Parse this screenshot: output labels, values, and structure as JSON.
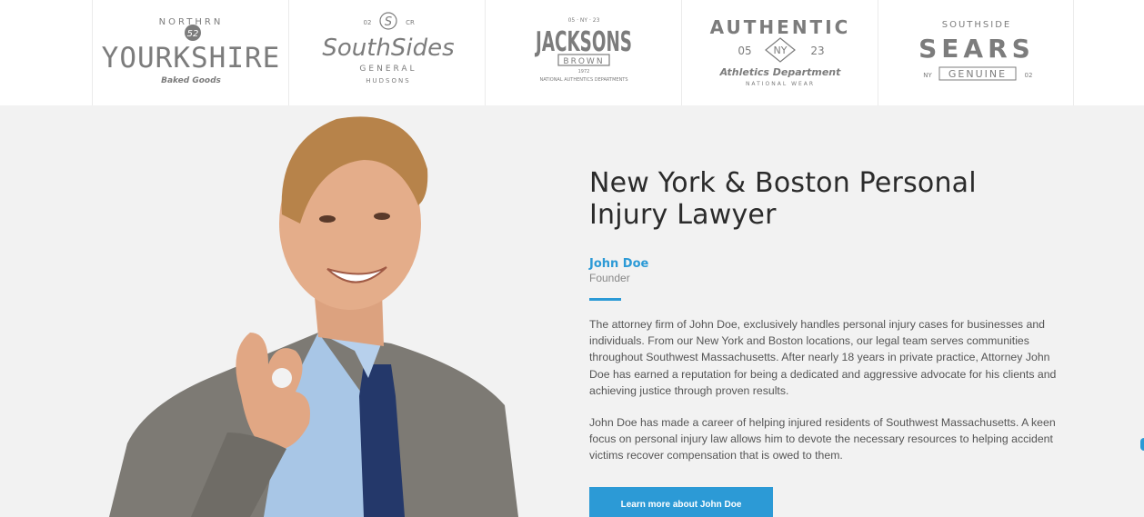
{
  "logos": [
    {
      "top": "NORTHRN",
      "badge": "52",
      "main": "YOURKSHIRE",
      "sub": "Baked Goods"
    },
    {
      "top_left": "02",
      "mono": "S",
      "top_right": "CR",
      "main": "SouthSides",
      "sub1": "GENERAL",
      "sub2": "HUDSONS"
    },
    {
      "top": "05 · NY · 23",
      "main": "JACKSONS",
      "band": "BROWN",
      "year": "1972",
      "sub": "NATIONAL AUTHENTICS DEPARTMENTS"
    },
    {
      "main": "AUTHENTIC",
      "left": "05",
      "badge": "NY",
      "right": "23",
      "script": "Athletics Department",
      "sub": "NATIONAL WEAR"
    },
    {
      "top": "SOUTHSIDE",
      "main": "SEARS",
      "left": "NY",
      "band": "GENUINE",
      "right": "02"
    }
  ],
  "hero": {
    "headline": "New York & Boston Personal Injury Lawyer",
    "author_name": "John Doe",
    "author_role": "Founder",
    "paragraph_1": "The attorney firm of John Doe, exclusively handles personal injury cases for businesses and individuals. From our New York and Boston locations, our legal team serves communities throughout Southwest Massachusetts. After nearly 18 years in private practice, Attorney John Doe has earned a reputation for being a dedicated and aggressive advocate for his clients and achieving justice through proven results.",
    "paragraph_2": "John Doe has made a career of helping injured residents of Southwest Massachusetts. A keen focus on personal injury law allows him to devote the necessary resources to helping accident victims recover compensation that is owed to them.",
    "cta_label": "Learn more about John Doe"
  },
  "colors": {
    "accent": "#2c9ad6",
    "logo_gray": "#7c7c7c",
    "hero_bg": "#f2f2f2"
  }
}
